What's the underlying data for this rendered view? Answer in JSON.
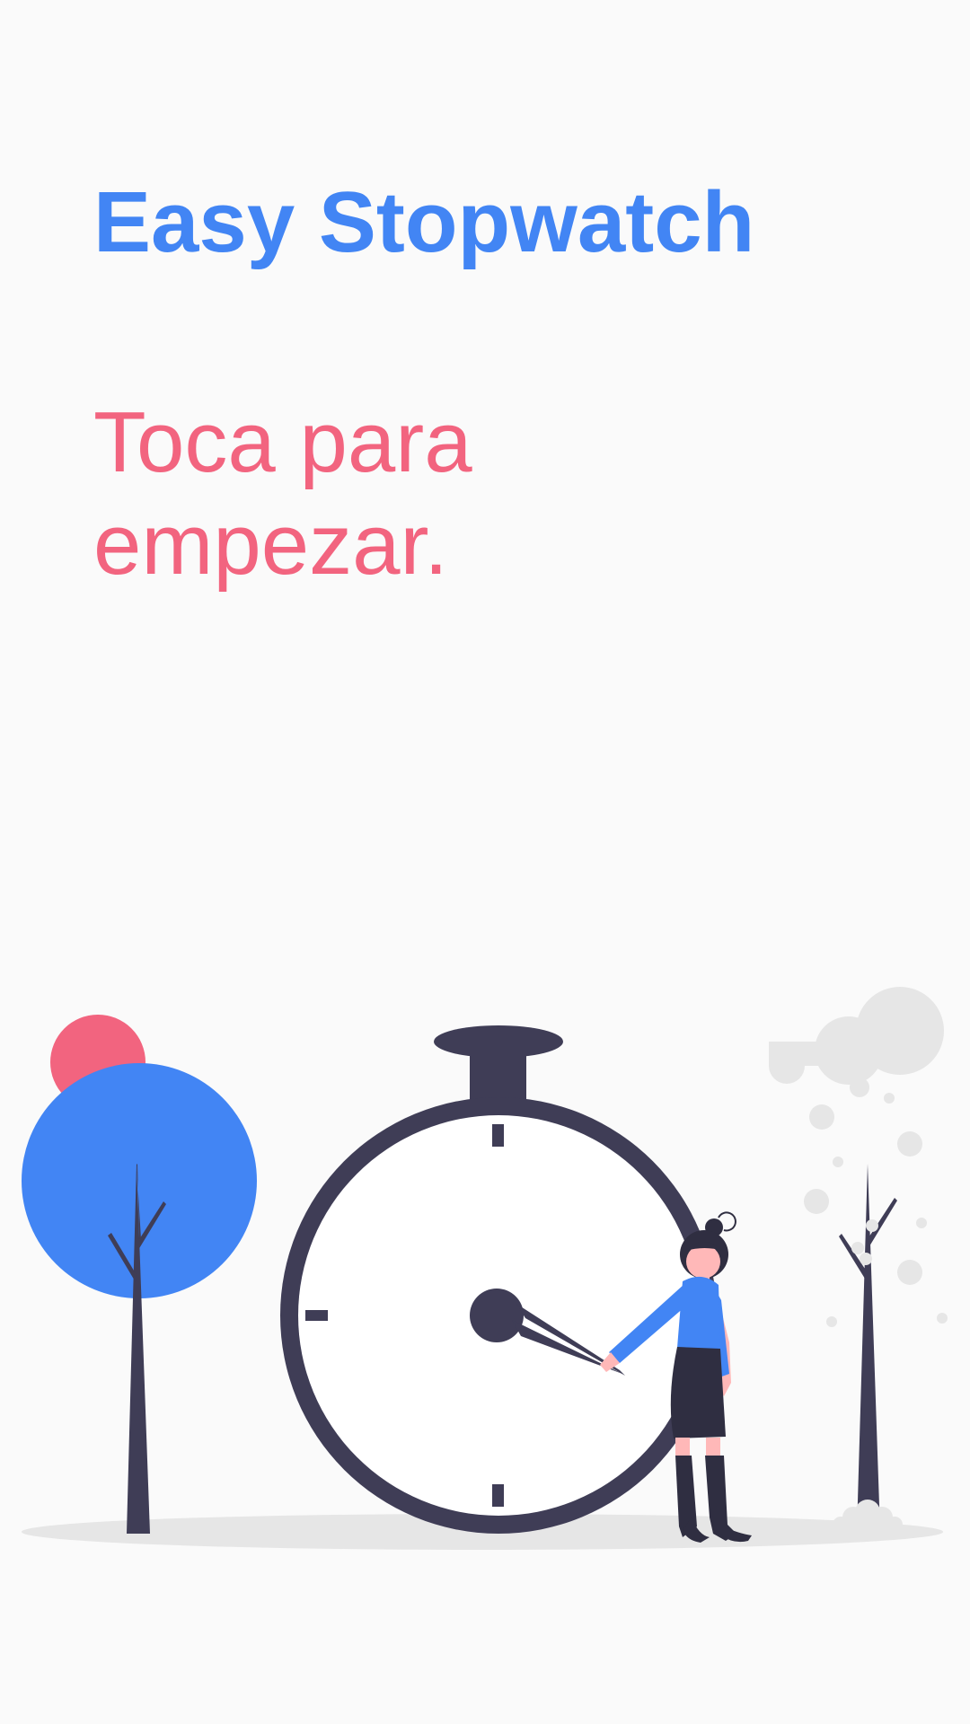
{
  "app": {
    "title": "Easy Stopwatch",
    "prompt": "Toca para empezar."
  },
  "colors": {
    "background": "#fafafa",
    "title": "#4285f4",
    "prompt": "#f2647f",
    "dark": "#3f3d56",
    "ground": "#e6e6e6",
    "skin": "#ffb8b8"
  },
  "illustration": {
    "subject": "person-pointing-at-stopwatch",
    "elements": [
      "tree-icon",
      "stopwatch-icon",
      "person-icon",
      "cloud-icon",
      "bare-tree-icon"
    ]
  }
}
